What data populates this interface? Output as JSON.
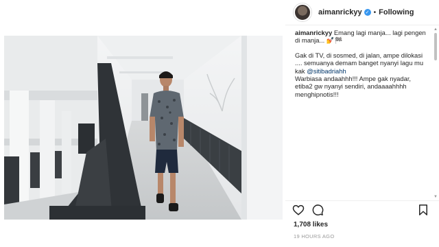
{
  "post": {
    "username": "aimanrickyy",
    "follow_status": "Following",
    "verified_mark": "✓",
    "dot": "•",
    "caption": {
      "line1_text": "Emang lagi manja... lagi pengen di manja... 💅🏁",
      "line2": "Gak di TV, di sosmed, di jalan, ampe dilokasi .... semuanya demam banget nyanyi lagu mu kak ",
      "mention": "@sitibadriahh",
      "line3": "Warbiasa andaahhh!!! Ampe gak nyadar, etiba2 gw nyanyi sendiri, andaaaahhhh menghipnotis!!!"
    },
    "likes": "1,708 likes",
    "time": "19 HOURS AGO"
  },
  "icons": {
    "heart": "heart-icon",
    "comment": "comment-icon",
    "bookmark": "bookmark-icon",
    "verified": "verified-badge-icon"
  },
  "colors": {
    "link": "#003569",
    "verified": "#3897f0",
    "muted": "#999999"
  }
}
